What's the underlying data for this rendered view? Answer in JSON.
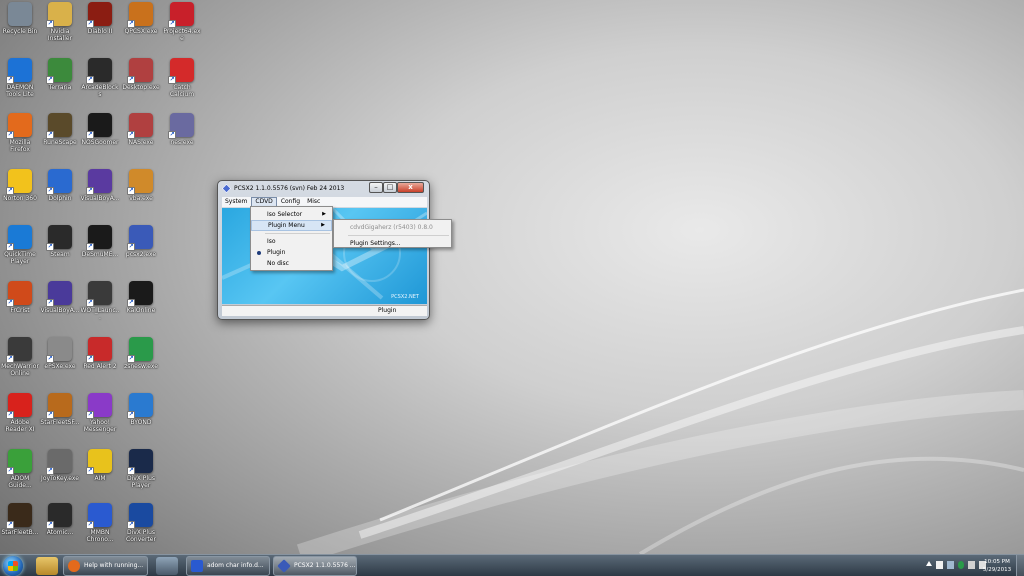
{
  "desktop": {
    "icons": [
      {
        "label": "Recycle Bin",
        "icon": "recycle-bin-icon",
        "color": "#7a8896"
      },
      {
        "label": "Nvidia Installer",
        "icon": "folder-icon",
        "color": "#d9b14a"
      },
      {
        "label": "Diablo II",
        "icon": "diablo-icon",
        "color": "#8b1d12"
      },
      {
        "label": "QPCSX.exe",
        "icon": "qpcsx-icon",
        "color": "#c9711c"
      },
      {
        "label": "Project64.exe",
        "icon": "project64-icon",
        "color": "#c8202a"
      },
      {
        "label": "DAEMON Tools Lite",
        "icon": "daemon-tools-icon",
        "color": "#1c72d6"
      },
      {
        "label": "Terraria",
        "icon": "terraria-icon",
        "color": "#3c8a3c"
      },
      {
        "label": "ArcadeBlocks",
        "icon": "arcade-icon",
        "color": "#2a2a2a"
      },
      {
        "label": "Desktop.exe",
        "icon": "app-icon",
        "color": "#b04040"
      },
      {
        "label": "Catch Calcium",
        "icon": "pokeball-icon",
        "color": "#d42a2a"
      },
      {
        "label": "Mozilla Firefox",
        "icon": "firefox-icon",
        "color": "#e36a1c"
      },
      {
        "label": "RuneScape",
        "icon": "runescape-icon",
        "color": "#5a4a2a"
      },
      {
        "label": "NOSGoomer",
        "icon": "nos-icon",
        "color": "#1a1a1a"
      },
      {
        "label": "NAS.exe",
        "icon": "app-icon",
        "color": "#b04040"
      },
      {
        "label": "nes.exe",
        "icon": "gamepad-icon",
        "color": "#6a6aa0"
      },
      {
        "label": "Norton 360",
        "icon": "norton-icon",
        "color": "#f2c21c"
      },
      {
        "label": "Dolphin",
        "icon": "dolphin-icon",
        "color": "#2a6ad0"
      },
      {
        "label": "VisualBoyA...",
        "icon": "vba-icon",
        "color": "#5a3aa0"
      },
      {
        "label": "vba.exe",
        "icon": "brush-icon",
        "color": "#d08a2a"
      },
      {
        "label": "QuickTime Player",
        "icon": "quicktime-icon",
        "color": "#1a7ad6"
      },
      {
        "label": "Steam",
        "icon": "steam-icon",
        "color": "#2a2a2a"
      },
      {
        "label": "DeSmuME...",
        "icon": "desmume-icon",
        "color": "#1a1a1a"
      },
      {
        "label": "pcsx2.exe",
        "icon": "pcsx2-icon",
        "color": "#3a5ab8"
      },
      {
        "label": "FrCrist",
        "icon": "app-icon",
        "color": "#d04a1a"
      },
      {
        "label": "VisualBoyA...",
        "icon": "vba-icon",
        "color": "#4a3a9a"
      },
      {
        "label": "WOT_Launc...",
        "icon": "wot-icon",
        "color": "#3a3a3a"
      },
      {
        "label": "KalOnline",
        "icon": "kal-icon",
        "color": "#1a1a1a"
      },
      {
        "label": "MechWarrior Online",
        "icon": "mw-icon",
        "color": "#3a3a3a"
      },
      {
        "label": "ePSXe.exe",
        "icon": "gamepad-icon",
        "color": "#8a8a8a"
      },
      {
        "label": "Red Alert 2",
        "icon": "redalert-icon",
        "color": "#c82a2a"
      },
      {
        "label": "zsnesw.exe",
        "icon": "zsnes-icon",
        "color": "#2a9a4a"
      },
      {
        "label": "Adobe Reader XI",
        "icon": "adobe-reader-icon",
        "color": "#d8221c"
      },
      {
        "label": "StarFleetSF...",
        "icon": "starfleet-icon",
        "color": "#b86a1c"
      },
      {
        "label": "Yahoo! Messenger",
        "icon": "yahoo-icon",
        "color": "#8a3ac8"
      },
      {
        "label": "BYOND",
        "icon": "byond-icon",
        "color": "#2a7ad0"
      },
      {
        "label": "ADOM Guide...",
        "icon": "adom-icon",
        "color": "#3aa03a"
      },
      {
        "label": "JoyToKey.exe",
        "icon": "joystick-icon",
        "color": "#6a6a6a"
      },
      {
        "label": "AIM",
        "icon": "aim-icon",
        "color": "#e8c21c"
      },
      {
        "label": "DivX Plus Player",
        "icon": "divx-icon",
        "color": "#1a2a4a"
      },
      {
        "label": "StarFleetB...",
        "icon": "starfleet-icon",
        "color": "#3a2a1a"
      },
      {
        "label": "Atomic...",
        "icon": "app-icon",
        "color": "#2a2a2a"
      },
      {
        "label": "MMBN Chrono...",
        "icon": "mmbn-icon",
        "color": "#2a5ad0"
      },
      {
        "label": "DivX Plus Converter",
        "icon": "divx-converter-icon",
        "color": "#1a4aa0"
      }
    ]
  },
  "window": {
    "title": "PCSX2  1.1.0.5576 (svn)  Feb 24 2013",
    "buttons": {
      "minimize": "–",
      "maximize": "□",
      "close": "x"
    },
    "menubar": [
      "System",
      "CDVD",
      "Config",
      "Misc"
    ],
    "status": "Plugin",
    "brand": "PCSX2.NET"
  },
  "cdvd_menu": {
    "items": [
      {
        "label": "Iso Selector",
        "submenu": true
      },
      {
        "label": "Plugin Menu",
        "submenu": true
      },
      {
        "label": "Iso"
      },
      {
        "label": "Plugin",
        "checked": true
      },
      {
        "label": "No disc"
      }
    ]
  },
  "plugin_submenu": {
    "items": [
      {
        "label": "cdvdGigaherz (r5403) 0.8.0",
        "disabled": true
      },
      {
        "label": "Plugin Settings..."
      }
    ]
  },
  "taskbar": {
    "tasks": [
      {
        "label": "Help with running...",
        "color": "#e36a1c"
      },
      {
        "label": "adom char info.d...",
        "color": "#2a5ad0"
      },
      {
        "label": "PCSX2  1.1.0.5576 ...",
        "color": "#3a5ab8"
      }
    ],
    "clock": {
      "time": "10:05 PM",
      "date": "5/29/2013"
    }
  }
}
